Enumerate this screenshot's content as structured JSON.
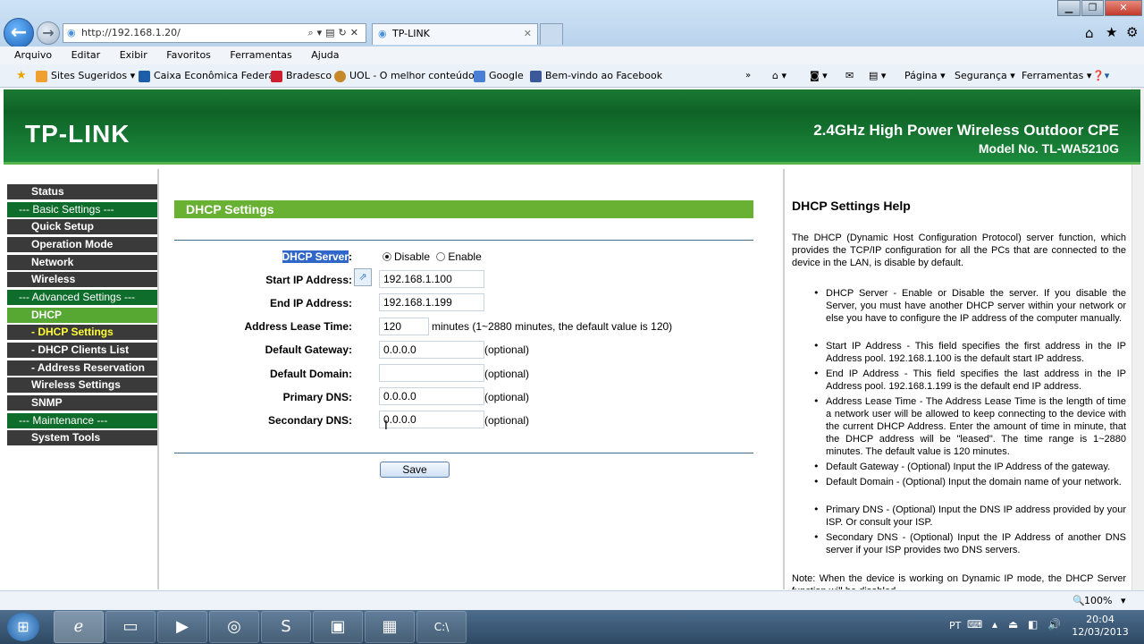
{
  "browser": {
    "url": "http://192.168.1.20/",
    "tab_title": "TP-LINK",
    "menu": [
      "Arquivo",
      "Editar",
      "Exibir",
      "Favoritos",
      "Ferramentas",
      "Ajuda"
    ],
    "favorites": [
      "Sites Sugeridos ▾",
      "Caixa Econômica Federal",
      "Bradesco",
      "UOL - O melhor conteúdo",
      "Google",
      "Bem-vindo ao Facebook"
    ],
    "toolbar": {
      "page": "Página ▾",
      "security": "Segurança ▾",
      "tools": "Ferramentas ▾"
    },
    "zoom": "100%"
  },
  "header": {
    "logo": "TP-LINK",
    "product": "2.4GHz High Power Wireless Outdoor CPE",
    "model": "Model No. TL-WA5210G"
  },
  "nav": [
    "Status",
    "--- Basic Settings ---",
    "Quick Setup",
    "Operation Mode",
    "Network",
    "Wireless",
    "--- Advanced Settings ---",
    "DHCP",
    "- DHCP Settings",
    "- DHCP Clients List",
    "- Address Reservation",
    "Wireless Settings",
    "SNMP",
    "--- Maintenance ---",
    "System Tools"
  ],
  "form": {
    "title": "DHCP Settings",
    "dhcp_server_label": "DHCP Server",
    "dhcp_server_colon": ":",
    "disable": "Disable",
    "enable": "Enable",
    "start_ip_label": "Start IP Address:",
    "start_ip": "192.168.1.100",
    "end_ip_label": "End IP Address:",
    "end_ip": "192.168.1.199",
    "lease_label": "Address Lease Time:",
    "lease": "120",
    "lease_note": "minutes (1~2880 minutes, the default value is 120)",
    "gateway_label": "Default Gateway:",
    "gateway": "0.0.0.0",
    "domain_label": "Default Domain:",
    "domain": "",
    "pdns_label": "Primary DNS:",
    "pdns": "0.0.0.0",
    "sdns_label": "Secondary DNS:",
    "sdns": "0.0.0.0",
    "optional": "(optional)",
    "save": "Save"
  },
  "help": {
    "title": "DHCP Settings Help",
    "intro": "The DHCP (Dynamic Host Configuration Protocol) server function, which provides the TCP/IP configuration for all the PCs that are connected to the device in the LAN, is disable by default.",
    "items": [
      "DHCP Server - Enable or Disable the server. If you disable the Server, you must have another DHCP server within your network or else you have to configure the IP address of the computer manually.",
      "Start IP Address - This field specifies the first address in the IP Address pool. 192.168.1.100 is the default start IP address.",
      "End IP Address - This field specifies the last address in the IP Address pool. 192.168.1.199 is the default end IP address.",
      "Address Lease Time - The Address Lease Time is the length of time a network user will be allowed to keep connecting to the device with the current DHCP Address. Enter the amount of time in minute, that the DHCP address will be \"leased\". The time range is 1~2880 minutes. The default value is 120 minutes.",
      "Default Gateway - (Optional) Input the IP Address of the gateway.",
      "Default Domain - (Optional) Input the domain name of your network.",
      "Primary DNS - (Optional) Input the DNS IP address provided by your ISP. Or consult your ISP.",
      "Secondary DNS - (Optional) Input the IP Address of another DNS server if your ISP provides two DNS servers."
    ],
    "note": "Note: When the device is working on Dynamic IP mode, the DHCP Server function will be disabled."
  },
  "taskbar": {
    "lang": "PT",
    "time": "20:04",
    "date": "12/03/2013"
  },
  "colors": {
    "header_green": "#0f6226",
    "section_green": "#68b133",
    "nav_dark": "#3a3a3a",
    "nav_active": "#57a832"
  }
}
